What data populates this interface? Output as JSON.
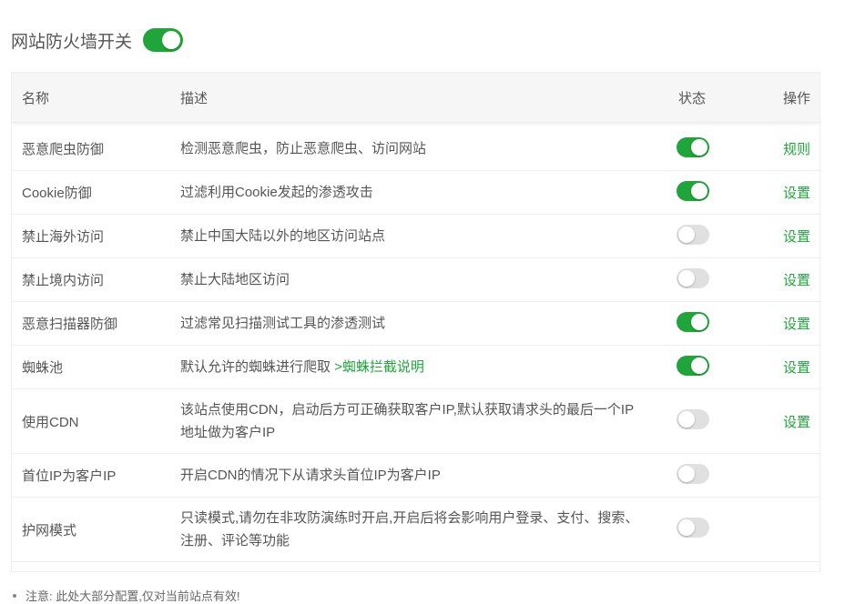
{
  "master": {
    "label": "网站防火墙开关",
    "enabled": true
  },
  "table": {
    "headers": {
      "name": "名称",
      "desc": "描述",
      "status": "状态",
      "op": "操作"
    },
    "rows": [
      {
        "name": "恶意爬虫防御",
        "desc": "检测恶意爬虫，防止恶意爬虫、访问网站",
        "link": "",
        "status": true,
        "op": "规则"
      },
      {
        "name": "Cookie防御",
        "desc": "过滤利用Cookie发起的渗透攻击",
        "link": "",
        "status": true,
        "op": "设置"
      },
      {
        "name": "禁止海外访问",
        "desc": "禁止中国大陆以外的地区访问站点",
        "link": "",
        "status": false,
        "op": "设置"
      },
      {
        "name": "禁止境内访问",
        "desc": "禁止大陆地区访问",
        "link": "",
        "status": false,
        "op": "设置"
      },
      {
        "name": "恶意扫描器防御",
        "desc": "过滤常见扫描测试工具的渗透测试",
        "link": "",
        "status": true,
        "op": "设置"
      },
      {
        "name": "蜘蛛池",
        "desc": "默认允许的蜘蛛进行爬取 ",
        "link": ">蜘蛛拦截说明",
        "status": true,
        "op": "设置"
      },
      {
        "name": "使用CDN",
        "desc": "该站点使用CDN，启动后方可正确获取客户IP,默认获取请求头的最后一个IP地址做为客户IP",
        "link": "",
        "status": false,
        "op": "设置"
      },
      {
        "name": "首位IP为客户IP",
        "desc": "开启CDN的情况下从请求头首位IP为客户IP",
        "link": "",
        "status": false,
        "op": ""
      },
      {
        "name": "护网模式",
        "desc": "只读模式,请勿在非攻防演练时开启,开启后将会影响用户登录、支付、搜索、注册、评论等功能",
        "link": "",
        "status": false,
        "op": ""
      }
    ]
  },
  "note": "注意: 此处大部分配置,仅对当前站点有效!",
  "colors": {
    "accent": "#20a53a",
    "toggle_off": "#e0e0e0"
  }
}
